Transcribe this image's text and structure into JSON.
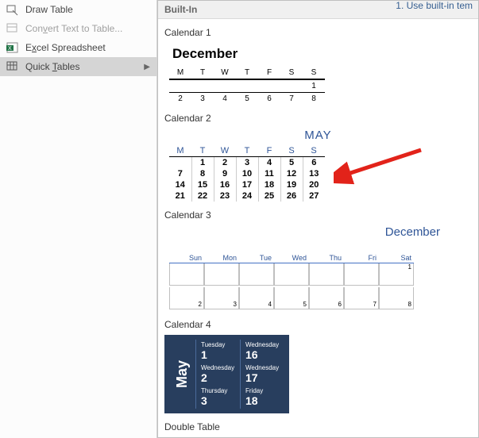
{
  "top_hint": "1. Use built-in tem",
  "menu": {
    "draw_table": "Draw Table",
    "convert": "Convert Text to Table...",
    "excel": "Excel Spreadsheet",
    "quick_tables": "Quick Tables"
  },
  "gallery": {
    "header": "Built-In",
    "cal1": {
      "title": "Calendar 1",
      "month": "December",
      "days": [
        "M",
        "T",
        "W",
        "T",
        "F",
        "S",
        "S"
      ],
      "row1": [
        "",
        "",
        "",
        "",
        "",
        "",
        "1"
      ],
      "row2": [
        "2",
        "3",
        "4",
        "5",
        "6",
        "7",
        "8"
      ]
    },
    "cal2": {
      "title": "Calendar 2",
      "month": "MAY",
      "days": [
        "M",
        "T",
        "W",
        "T",
        "F",
        "S",
        "S"
      ],
      "rows": [
        [
          "",
          "1",
          "2",
          "3",
          "4",
          "5",
          "6"
        ],
        [
          "7",
          "8",
          "9",
          "10",
          "11",
          "12",
          "13"
        ],
        [
          "14",
          "15",
          "16",
          "17",
          "18",
          "19",
          "20"
        ],
        [
          "21",
          "22",
          "23",
          "24",
          "25",
          "26",
          "27"
        ]
      ]
    },
    "cal3": {
      "title": "Calendar 3",
      "month": "December",
      "days": [
        "Sun",
        "Mon",
        "Tue",
        "Wed",
        "Thu",
        "Fri",
        "Sat"
      ],
      "top_nums": [
        "",
        "",
        "",
        "",
        "",
        "",
        "1"
      ],
      "bot_nums": [
        "2",
        "3",
        "4",
        "5",
        "6",
        "7",
        "8"
      ]
    },
    "cal4": {
      "title": "Calendar 4",
      "month": "May",
      "cells": [
        {
          "dow": "Tuesday",
          "num": "1"
        },
        {
          "dow": "Wednesday",
          "num": "2"
        },
        {
          "dow": "Thursday",
          "num": "3"
        },
        {
          "dow": "Wednesday",
          "num": "16"
        },
        {
          "dow": "Wednesday",
          "num": "17"
        },
        {
          "dow": "Friday",
          "num": "18"
        }
      ]
    },
    "double_table": "Double Table"
  }
}
